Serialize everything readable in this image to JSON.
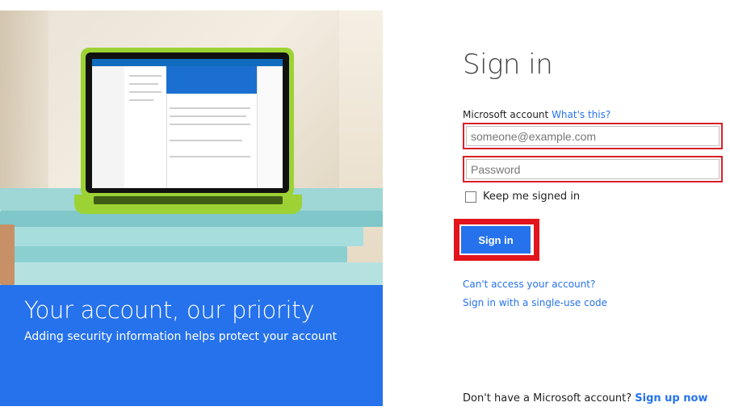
{
  "hero": {
    "title": "Your account, our priority",
    "subtitle": "Adding security information helps protect your account",
    "accent_color": "#2672ec"
  },
  "signin": {
    "heading": "Sign in",
    "account_label": "Microsoft account",
    "whats_this_link": "What's this?",
    "email_placeholder": "someone@example.com",
    "password_placeholder": "Password",
    "keep_signed_in_label": "Keep me signed in",
    "submit_label": "Sign in",
    "cant_access_link": "Can't access your account?",
    "single_use_link": "Sign in with a single-use code",
    "no_account_text": "Don't have a Microsoft account?",
    "signup_link": "Sign up now"
  }
}
